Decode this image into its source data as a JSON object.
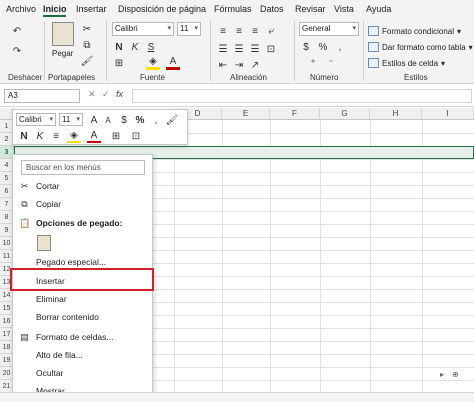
{
  "tabs": [
    "Archivo",
    "Inicio",
    "Insertar",
    "Disposición de página",
    "Fórmulas",
    "Datos",
    "Revisar",
    "Vista",
    "Ayuda"
  ],
  "ribbon": {
    "undo_label": "Deshacer",
    "clipboard_label": "Portapapeles",
    "paste_label": "Pegar",
    "font_label": "Fuente",
    "font_name": "Calibri",
    "font_size": "11",
    "alignment_label": "Alineación",
    "number_label": "Número",
    "number_format": "General",
    "styles_label": "Estilos",
    "conditional_format": "Formato condicional",
    "format_as_table": "Dar formato como tabla",
    "cell_styles": "Estilos de celda"
  },
  "formula_bar": {
    "name_box": "A3",
    "fx": "fx"
  },
  "grid": {
    "columns": [
      "D",
      "E",
      "F",
      "G",
      "H",
      "I"
    ],
    "rows": [
      "1",
      "2",
      "3",
      "4",
      "5",
      "6",
      "7",
      "8",
      "9",
      "10",
      "11",
      "12",
      "13",
      "14",
      "15",
      "16",
      "17",
      "18",
      "19",
      "20",
      "21"
    ]
  },
  "mini_toolbar": {
    "font_name": "Calibri",
    "font_size": "11",
    "bold": "N",
    "italic": "K",
    "percent": "%",
    "accent_color": "#c00000"
  },
  "context_menu": {
    "search_placeholder": "Buscar en los menús",
    "items": [
      {
        "label": "Cortar",
        "icon": "scissors-icon"
      },
      {
        "label": "Copiar",
        "icon": "copy-icon"
      },
      {
        "label": "Opciones de pegado:",
        "icon": "paste-icon"
      },
      {
        "label": "Pegado especial...",
        "icon": ""
      },
      {
        "label": "Insertar",
        "icon": ""
      },
      {
        "label": "Eliminar",
        "icon": ""
      },
      {
        "label": "Borrar contenido",
        "icon": ""
      },
      {
        "label": "Formato de celdas...",
        "icon": "format-cells-icon"
      },
      {
        "label": "Alto de fila...",
        "icon": ""
      },
      {
        "label": "Ocultar",
        "icon": ""
      },
      {
        "label": "Mostrar",
        "icon": ""
      }
    ]
  },
  "colors": {
    "accent": "#217346",
    "highlight_border": "#d0222b"
  }
}
